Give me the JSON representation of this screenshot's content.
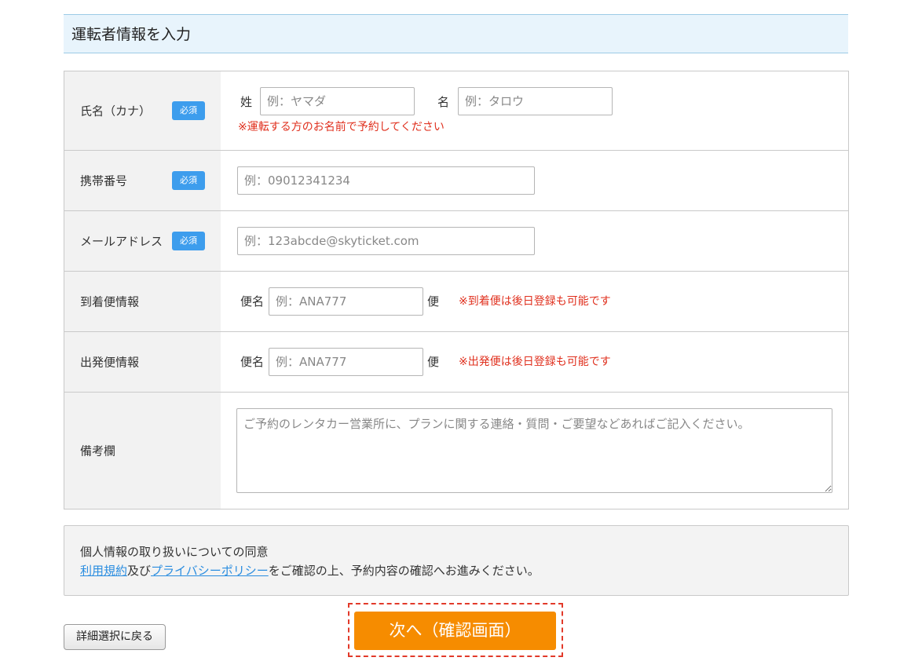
{
  "section": {
    "title": "運転者情報を入力"
  },
  "colors": {
    "accent_blue": "#3d9ded",
    "required_badge": "#3d9ded",
    "warning_red": "#e0301e",
    "next_orange": "#f68c00",
    "link_blue": "#2a8de0"
  },
  "required_badge_label": "必須",
  "form": {
    "name_kana": {
      "label": "氏名（カナ）",
      "sei_label": "姓",
      "sei_placeholder": "例：ヤマダ",
      "mei_label": "名",
      "mei_placeholder": "例：タロウ",
      "note": "※運転する方のお名前で予約してください"
    },
    "phone": {
      "label": "携帯番号",
      "placeholder": "例：09012341234"
    },
    "email": {
      "label": "メールアドレス",
      "placeholder": "例：123abcde@skyticket.com"
    },
    "arrival_flight": {
      "label": "到着便情報",
      "prefix": "便名",
      "placeholder": "例：ANA777",
      "suffix": "便",
      "note": "※到着便は後日登録も可能です"
    },
    "departure_flight": {
      "label": "出発便情報",
      "prefix": "便名",
      "placeholder": "例：ANA777",
      "suffix": "便",
      "note": "※出発便は後日登録も可能です"
    },
    "remarks": {
      "label": "備考欄",
      "placeholder": "ご予約のレンタカー営業所に、プランに関する連絡・質問・ご要望などあればご記入ください。"
    }
  },
  "consent": {
    "heading": "個人情報の取り扱いについての同意",
    "terms_link": "利用規約",
    "and_text": "及び",
    "privacy_link": "プライバシーポリシー",
    "rest_text": "をご確認の上、予約内容の確認へお進みください。"
  },
  "actions": {
    "back_label": "詳細選択に戻る",
    "next_label": "次へ（確認画面）"
  }
}
